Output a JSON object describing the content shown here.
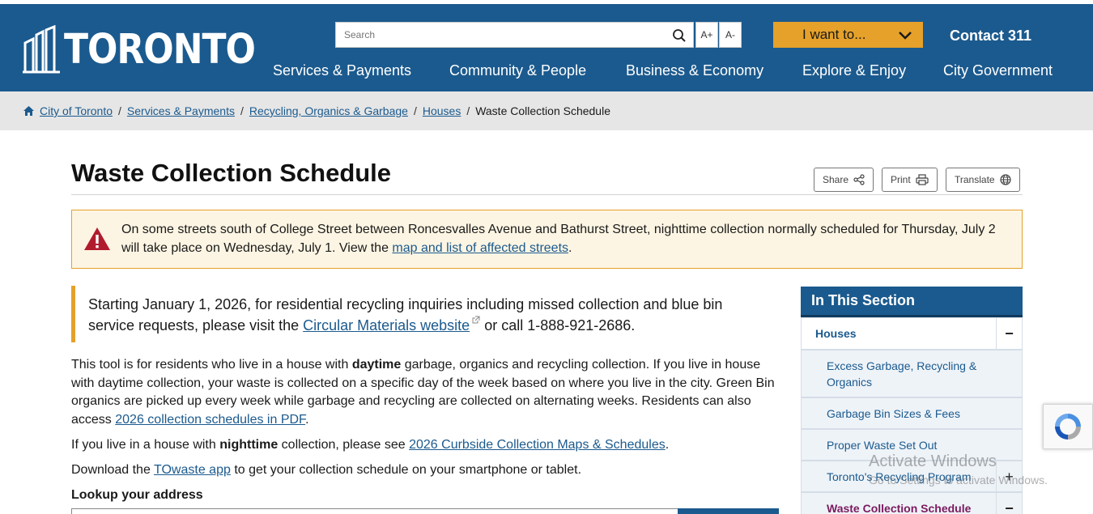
{
  "header": {
    "logo_text": "TORONTO",
    "search_placeholder": "Search",
    "font_increase": "A+",
    "font_decrease": "A-",
    "iwant_label": "I want to...",
    "contact_label": "Contact 311",
    "nav": [
      "Services & Payments",
      "Community & People",
      "Business & Economy",
      "Explore & Enjoy",
      "City Government"
    ]
  },
  "breadcrumb": {
    "items": [
      "City of Toronto",
      "Services & Payments",
      "Recycling, Organics & Garbage",
      "Houses"
    ],
    "current": "Waste Collection Schedule",
    "separator": "/"
  },
  "page": {
    "title": "Waste Collection Schedule",
    "share_label": "Share",
    "print_label": "Print",
    "translate_label": "Translate"
  },
  "alert": {
    "text_before": "On some streets south of College Street between Roncesvalles Avenue and Bathurst Street, nighttime collection normally scheduled for Thursday, July 2 will take place on Wednesday, July 1. View the ",
    "link": "map and list of affected streets",
    "text_after": "."
  },
  "callout": {
    "text_before": "Starting January 1, 2026, for residential recycling inquiries including missed collection and blue bin service requests, please visit the ",
    "link": "Circular Materials website",
    "text_after": " or call 1-888-921-2686."
  },
  "body": {
    "p1_a": "This tool is for residents who live in a house with ",
    "p1_bold": "daytime",
    "p1_b": " garbage, organics and recycling collection. If you live in house with daytime collection, your waste is collected on a specific day of the week based on where you live in the city. Green Bin organics are picked up every week while garbage and recycling are collected on alternating weeks. Residents can also access ",
    "p1_link": "2026 collection schedules in PDF",
    "p1_c": ".",
    "p2_a": "If you live in a house with ",
    "p2_bold": "nighttime",
    "p2_b": " collection, please see ",
    "p2_link": "2026 Curbside Collection Maps & Schedules",
    "p2_c": ".",
    "p3_a": "Download the ",
    "p3_link": "TOwaste app",
    "p3_b": " to get your collection schedule on your smartphone or tablet.",
    "lookup_label": "Lookup your address"
  },
  "sidebar": {
    "heading": "In This Section",
    "section": "Houses",
    "items": [
      "Excess Garbage, Recycling & Organics",
      "Garbage Bin Sizes & Fees",
      "Proper Waste Set Out",
      "Toronto's Recycling Program",
      "Waste Collection Schedule"
    ],
    "toggle_minus": "−",
    "toggle_plus": "+"
  },
  "watermark": {
    "line1": "Activate Windows",
    "line2": "Go to Settings to activate Windows."
  },
  "colors": {
    "brand_blue": "#1b5a8e",
    "accent_gold": "#e5a12a",
    "alert_red": "#b01c2e"
  }
}
